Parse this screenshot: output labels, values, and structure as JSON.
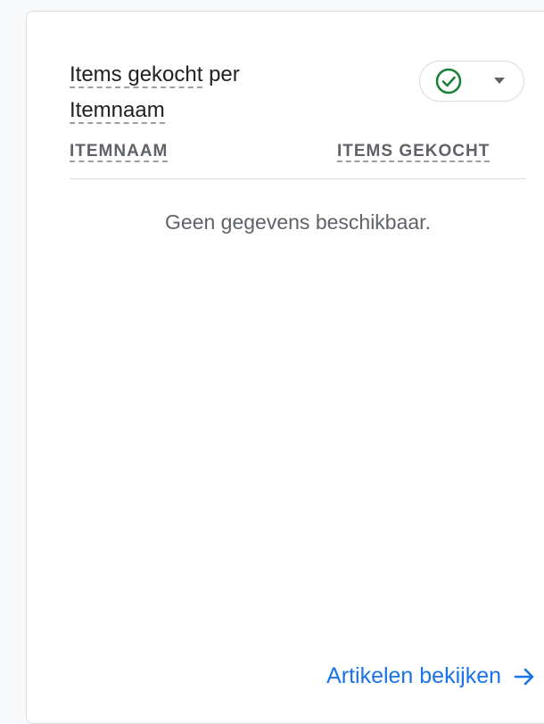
{
  "card": {
    "title_part1": "Items gekocht",
    "title_part2": " per ",
    "title_part3": "Itemnaam",
    "status_icon": "check-circle-icon",
    "dropdown_icon": "caret-down-icon"
  },
  "table": {
    "columns": [
      "ITEMNAAM",
      "ITEMS GEKOCHT"
    ],
    "empty_message": "Geen gegevens beschikbaar."
  },
  "footer": {
    "link_label": "Artikelen bekijken",
    "arrow_icon": "arrow-right-icon"
  },
  "colors": {
    "accent": "#1a73e8",
    "success": "#188038",
    "text_primary": "#202124",
    "text_secondary": "#5f6368",
    "border": "#dadce0"
  }
}
